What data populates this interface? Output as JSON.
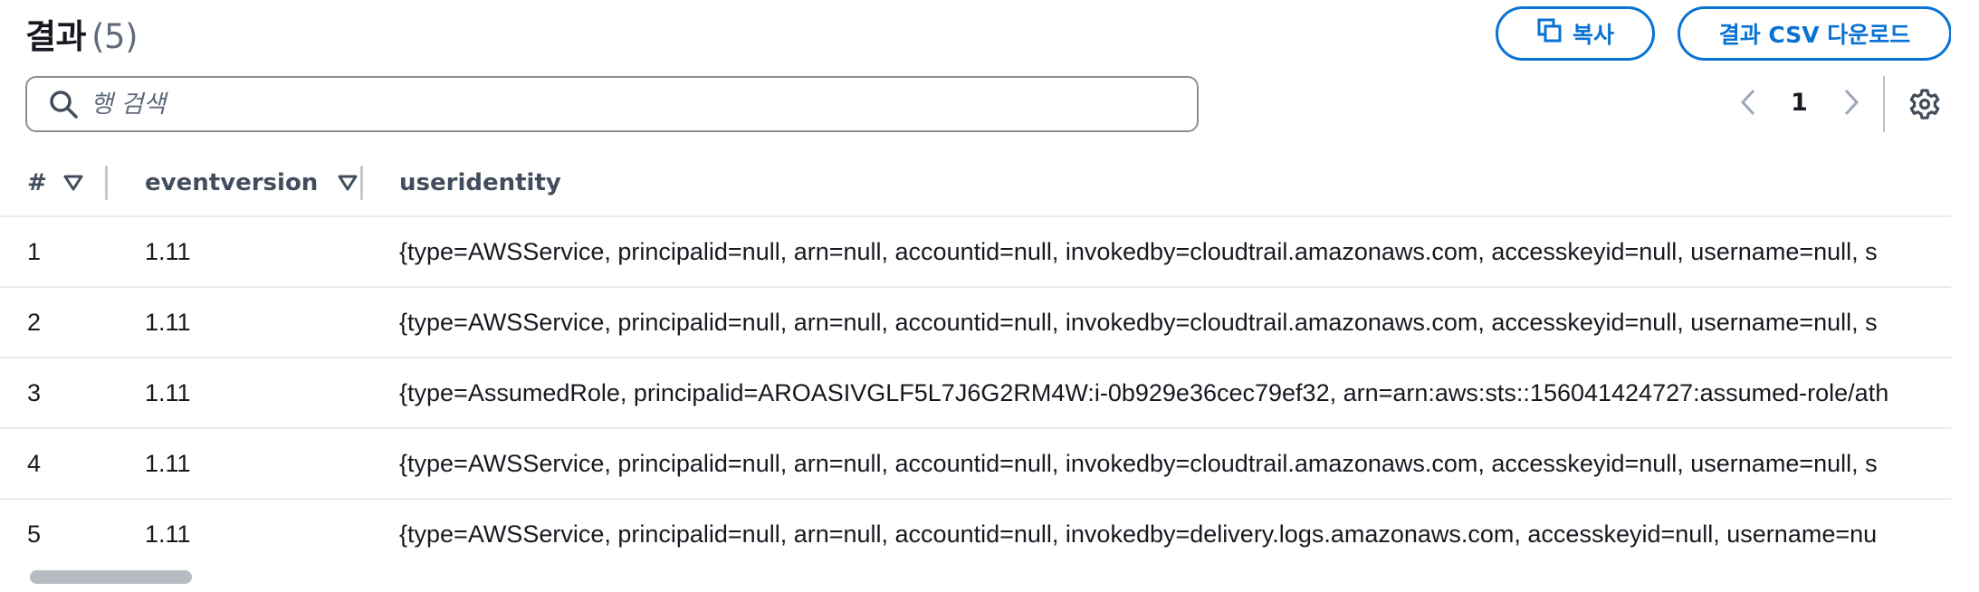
{
  "header": {
    "title": "결과",
    "count": "(5)",
    "copy_label": "복사",
    "csv_label": "결과 CSV 다운로드"
  },
  "search": {
    "placeholder": "행 검색",
    "value": ""
  },
  "pagination": {
    "current_page": "1"
  },
  "table": {
    "columns": [
      "#",
      "eventversion",
      "useridentity"
    ],
    "rows": [
      [
        "1",
        "1.11",
        "{type=AWSService, principalid=null, arn=null, accountid=null, invokedby=cloudtrail.amazonaws.com, accesskeyid=null, username=null, s"
      ],
      [
        "2",
        "1.11",
        "{type=AWSService, principalid=null, arn=null, accountid=null, invokedby=cloudtrail.amazonaws.com, accesskeyid=null, username=null, s"
      ],
      [
        "3",
        "1.11",
        "{type=AssumedRole, principalid=AROASIVGLF5L7J6G2RM4W:i-0b929e36cec79ef32, arn=arn:aws:sts::156041424727:assumed-role/ath"
      ],
      [
        "4",
        "1.11",
        "{type=AWSService, principalid=null, arn=null, accountid=null, invokedby=cloudtrail.amazonaws.com, accesskeyid=null, username=null, s"
      ],
      [
        "5",
        "1.11",
        "{type=AWSService, principalid=null, arn=null, accountid=null, invokedby=delivery.logs.amazonaws.com, accesskeyid=null, username=nu"
      ]
    ]
  },
  "icons": {
    "copy": "copy-icon",
    "search": "search-icon",
    "prev": "chevron-left-icon",
    "next": "chevron-right-icon",
    "settings": "gear-icon",
    "sort": "sort-triangle-icon"
  },
  "colors": {
    "accent": "#0972d3",
    "text": "#16191f",
    "muted": "#5f6b7a",
    "header_text": "#414d5c",
    "row_border": "#e9ebed"
  }
}
